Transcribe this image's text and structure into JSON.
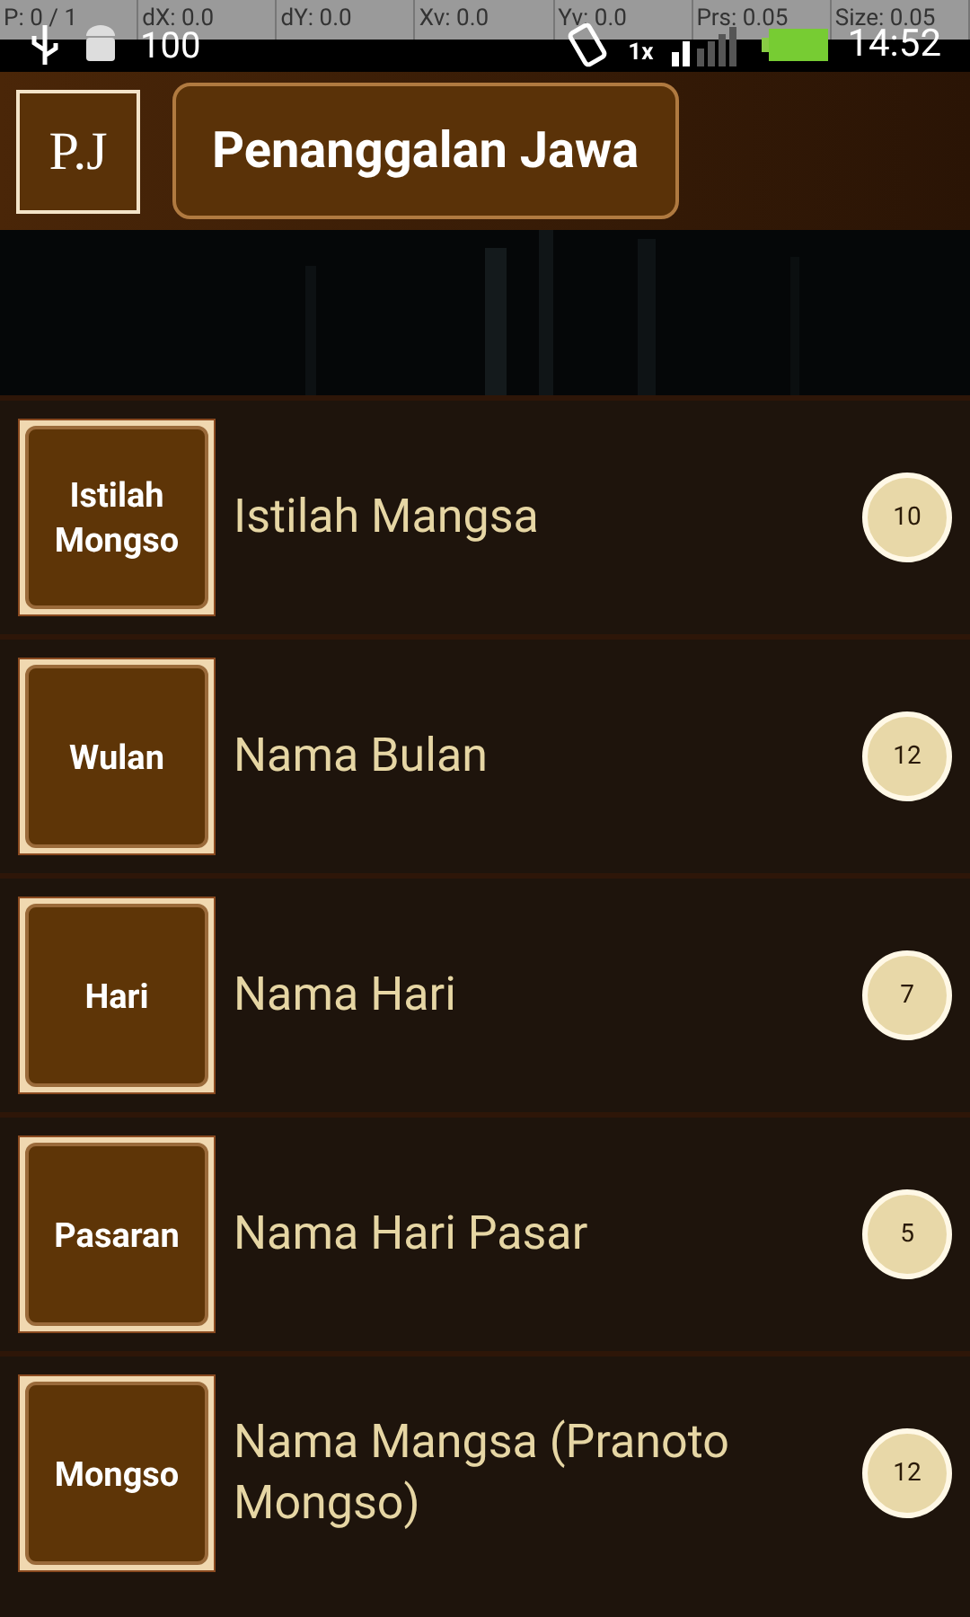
{
  "debug_overlay": [
    "P: 0 / 1",
    "dX: 0.0",
    "dY: 0.0",
    "Xv: 0.0",
    "Yv: 0.0",
    "Prs: 0.05",
    "Size: 0.05"
  ],
  "status_bar": {
    "battery_percent": "100",
    "time": "14:52",
    "network": "1x"
  },
  "header": {
    "logo": "P.J",
    "title": "Penanggalan Jawa"
  },
  "items": [
    {
      "icon_label": "Istilah Mongso",
      "title": "Istilah Mangsa",
      "count": "10"
    },
    {
      "icon_label": "Wulan",
      "title": "Nama Bulan",
      "count": "12"
    },
    {
      "icon_label": "Hari",
      "title": "Nama Hari",
      "count": "7"
    },
    {
      "icon_label": "Pasaran",
      "title": "Nama Hari Pasar",
      "count": "5"
    },
    {
      "icon_label": "Mongso",
      "title": "Nama Mangsa (Pranoto Mongso)",
      "count": "12"
    }
  ]
}
